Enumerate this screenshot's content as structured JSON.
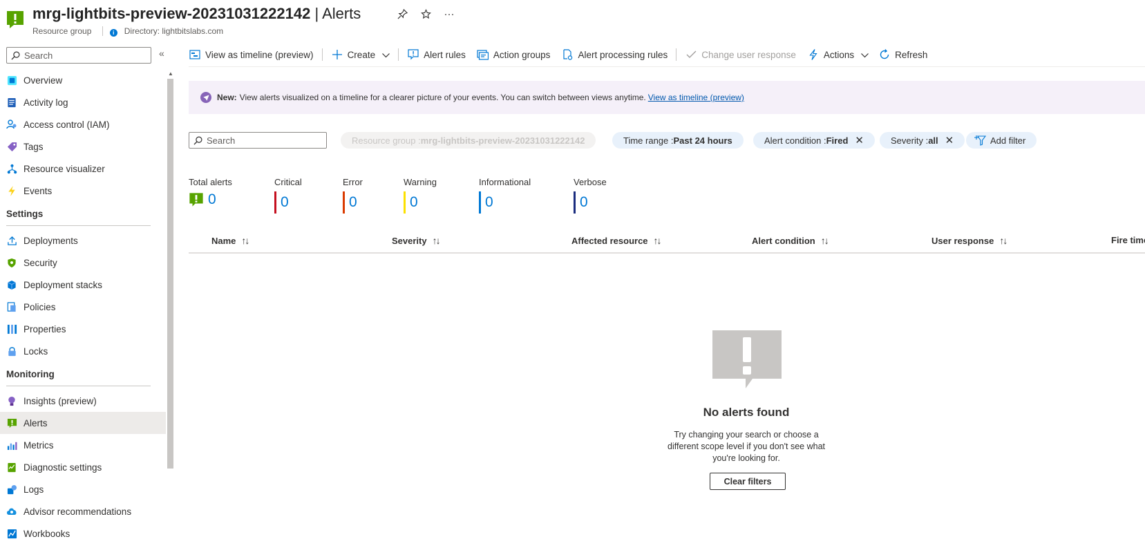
{
  "header": {
    "resource_name": "mrg-lightbits-preview-20231031222142",
    "separator": "|",
    "page": "Alerts",
    "resource_type": "Resource group",
    "directory": "Directory: lightbitslabs.com"
  },
  "sidebar": {
    "search_placeholder": "Search",
    "items_top": [
      {
        "label": "Overview",
        "icon": "overview-icon"
      },
      {
        "label": "Activity log",
        "icon": "activity-log-icon"
      },
      {
        "label": "Access control (IAM)",
        "icon": "iam-icon"
      },
      {
        "label": "Tags",
        "icon": "tag-icon"
      },
      {
        "label": "Resource visualizer",
        "icon": "visualizer-icon"
      },
      {
        "label": "Events",
        "icon": "lightning-icon"
      }
    ],
    "section_settings": "Settings",
    "items_settings": [
      {
        "label": "Deployments",
        "icon": "deploy-icon"
      },
      {
        "label": "Security",
        "icon": "shield-icon"
      },
      {
        "label": "Deployment stacks",
        "icon": "stack-icon"
      },
      {
        "label": "Policies",
        "icon": "policy-icon"
      },
      {
        "label": "Properties",
        "icon": "properties-icon"
      },
      {
        "label": "Locks",
        "icon": "lock-icon"
      }
    ],
    "section_monitoring": "Monitoring",
    "items_monitoring": [
      {
        "label": "Insights (preview)",
        "icon": "insights-icon"
      },
      {
        "label": "Alerts",
        "icon": "alert-icon",
        "active": true
      },
      {
        "label": "Metrics",
        "icon": "metrics-icon"
      },
      {
        "label": "Diagnostic settings",
        "icon": "diagnostic-icon"
      },
      {
        "label": "Logs",
        "icon": "logs-icon"
      },
      {
        "label": "Advisor recommendations",
        "icon": "advisor-icon"
      },
      {
        "label": "Workbooks",
        "icon": "workbooks-icon"
      }
    ]
  },
  "toolbar": {
    "view_timeline": "View as timeline (preview)",
    "create": "Create",
    "alert_rules": "Alert rules",
    "action_groups": "Action groups",
    "alert_processing_rules": "Alert processing rules",
    "change_user_response": "Change user response",
    "actions": "Actions",
    "refresh": "Refresh"
  },
  "banner": {
    "new_label": "New:",
    "text": "View alerts visualized on a timeline for a clearer picture of your events. You can switch between views anytime.",
    "link": "View as timeline (preview)"
  },
  "filters": {
    "search_placeholder": "Search",
    "resource_group_label": "Resource group : ",
    "resource_group_value": "mrg-lightbits-preview-20231031222142",
    "time_range_label": "Time range : ",
    "time_range_value": "Past 24 hours",
    "alert_condition_label": "Alert condition : ",
    "alert_condition_value": "Fired",
    "severity_label": "Severity : ",
    "severity_value": "all",
    "add_filter": "Add filter"
  },
  "summary": {
    "total": {
      "label": "Total alerts",
      "value": "0"
    },
    "critical": {
      "label": "Critical",
      "value": "0",
      "color": "#c50f1f"
    },
    "error": {
      "label": "Error",
      "value": "0",
      "color": "#da3b01"
    },
    "warning": {
      "label": "Warning",
      "value": "0",
      "color": "#fce100"
    },
    "informational": {
      "label": "Informational",
      "value": "0",
      "color": "#0078d4"
    },
    "verbose": {
      "label": "Verbose",
      "value": "0",
      "color": "#1b2d7f"
    }
  },
  "table": {
    "columns": [
      "Name",
      "Severity",
      "Affected resource",
      "Alert condition",
      "User response",
      "Fire time"
    ]
  },
  "empty_state": {
    "title": "No alerts found",
    "description": "Try changing your search or choose a different scope level if you don't see what you're looking for.",
    "button": "Clear filters"
  },
  "colors": {
    "accent": "#0078d4",
    "alert_green": "#57a300"
  }
}
